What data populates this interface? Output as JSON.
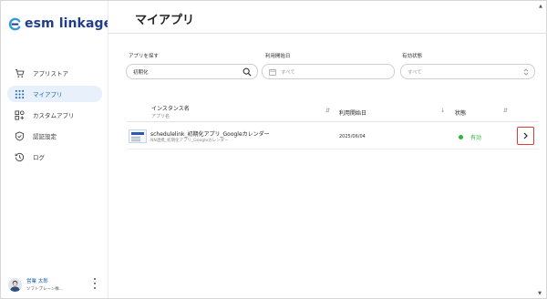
{
  "brand": {
    "name": "esm linkage",
    "color": "#1f3d8a",
    "mark_color": "#3a9ad9"
  },
  "sidebar": {
    "items": [
      {
        "label": "アプリストア",
        "icon": "cart-icon",
        "active": false
      },
      {
        "label": "マイアプリ",
        "icon": "grid-dots-icon",
        "active": true
      },
      {
        "label": "カスタムアプリ",
        "icon": "custom-app-icon",
        "active": false
      },
      {
        "label": "認証設定",
        "icon": "shield-icon",
        "active": false
      },
      {
        "label": "ログ",
        "icon": "history-icon",
        "active": false
      }
    ]
  },
  "user": {
    "name": "営業 太郎",
    "org": "ソフトブレーン株..."
  },
  "header": {
    "title": "マイアプリ"
  },
  "filters": {
    "search": {
      "label": "アプリを探す",
      "value": "初期化"
    },
    "start_date": {
      "label": "利用開始日",
      "placeholder": "すべて"
    },
    "status": {
      "label": "有効状態",
      "placeholder": "すべて"
    }
  },
  "table": {
    "columns": {
      "instance": "インスタンス名",
      "instance_sub": "アプリ名",
      "start_date": "利用開始日",
      "status": "状態"
    },
    "rows": [
      {
        "name": "schedulelink_初期化アプリ_Googleカレンダー",
        "app": "NN連携_初期化アプリ_Googleカレンダー",
        "start_date": "2025/06/04",
        "status": "有効"
      }
    ]
  },
  "colors": {
    "accent": "#1a5fb4",
    "active_bg": "#e7f0fb",
    "status_active": "#2fb344",
    "highlight": "#e03a3a"
  }
}
